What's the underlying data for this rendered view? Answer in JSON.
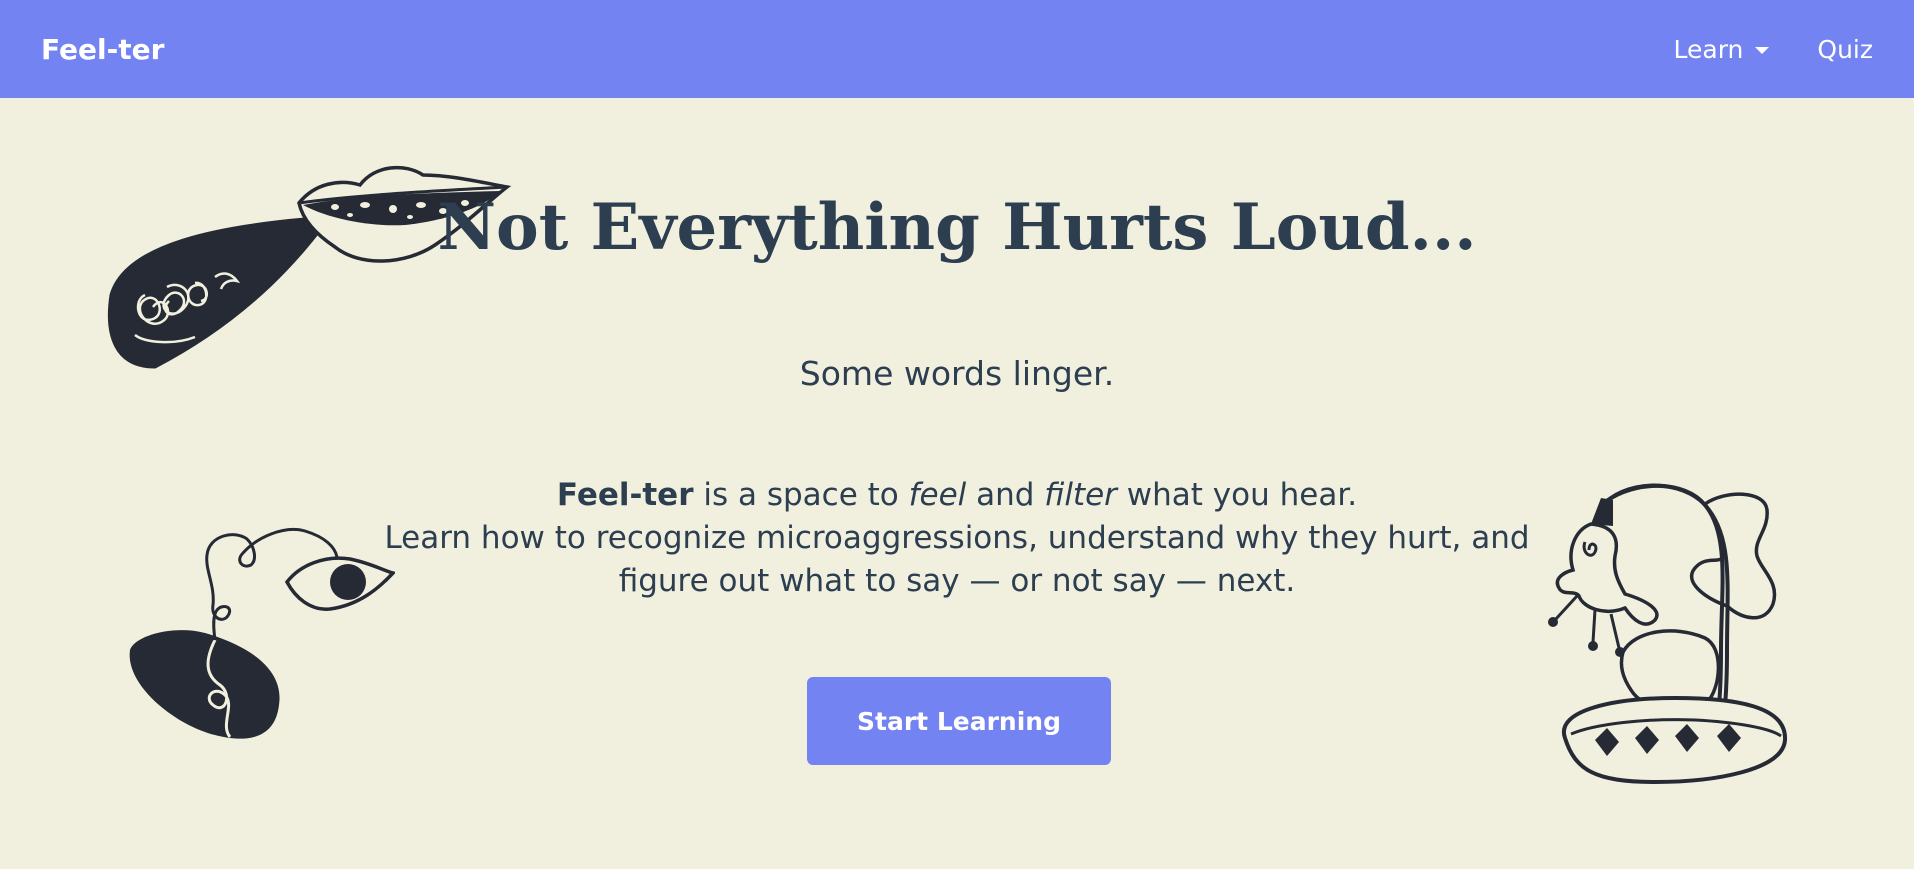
{
  "nav": {
    "brand": "Feel-ter",
    "learn_label": "Learn",
    "quiz_label": "Quiz"
  },
  "hero": {
    "title": "Not Everything Hurts Loud...",
    "tagline": "Some words linger.",
    "intro": {
      "brand": "Feel-ter",
      "text1": " is a space to ",
      "feel": "feel",
      "text2": " and ",
      "filter": "filter",
      "text3": " what you hear.",
      "line2": "Learn how to recognize microaggressions, understand why they hurt, and figure out what to say — or not say — next."
    },
    "cta_label": "Start Learning"
  },
  "colors": {
    "nav_bg": "#7483f2",
    "page_bg": "#f1f0df",
    "text": "#2c3e50",
    "ink": "#262a34"
  },
  "icons": {
    "illustration_1": "lips-speech-bubble-icon",
    "illustration_2": "eye-vine-icon",
    "illustration_3": "lamp-flower-icon"
  }
}
